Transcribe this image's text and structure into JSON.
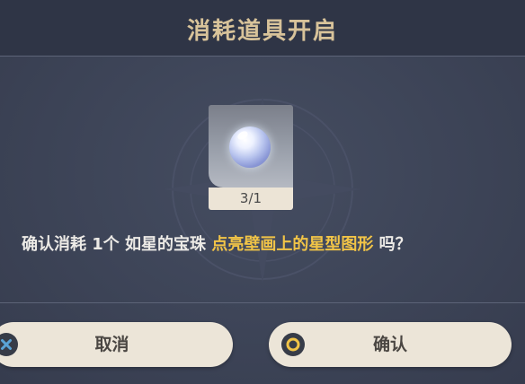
{
  "dialog": {
    "title": "消耗道具开启",
    "item": {
      "name": "如星的宝珠",
      "count_label": "3/1",
      "icon": "star-orb-icon"
    },
    "message": {
      "prefix": "确认消耗 1个 如星的宝珠 ",
      "highlight": "点亮壁画上的星型图形",
      "suffix": " 吗？"
    },
    "buttons": {
      "cancel": {
        "label": "取消",
        "icon": "cross-circle-icon"
      },
      "confirm": {
        "label": "确认",
        "icon": "ring-circle-icon"
      }
    }
  },
  "colors": {
    "background": "#3f4659",
    "title": "#d8c39a",
    "highlight": "#f1c447",
    "button": "#ece5d8",
    "cancel_icon": "#5aa3d6",
    "confirm_icon": "#f1c447"
  }
}
